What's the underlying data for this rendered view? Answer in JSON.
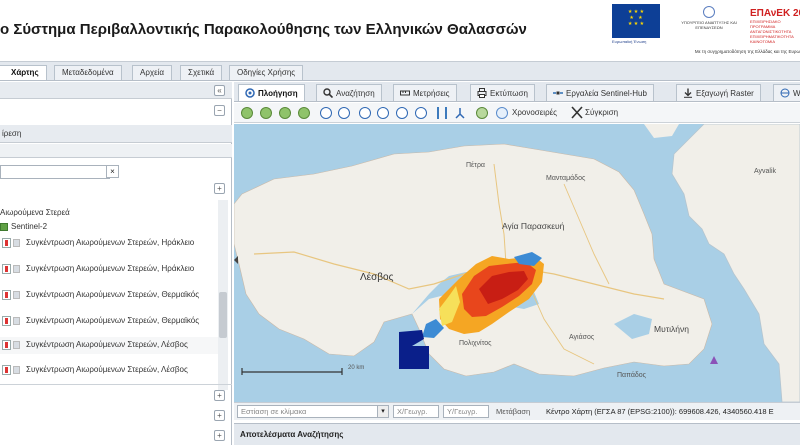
{
  "header": {
    "title": "ο Σύστημα Περιβαλλοντικής Παρακολούθησης των Ελληνικών Θαλασσών",
    "eu_caption": "Ευρωπαϊκή Ένωση",
    "gr_caption": "ΥΠΟΥΡΓΕΙΟ ΑΝΑΠΤΥΞΗΣ ΚΑΙ ΕΠΕΝΔΥΣΕΩΝ",
    "epanek_title": "ΕΠΑνΕΚ 20",
    "epanek_sub": "ΕΠΙΧΕΙΡΗΣΙΑΚΟ ΠΡΟΓΡΑΜΜΑ ΑΝΤΑΓΩΝΙΣΤΙΚΟΤΗΤΑ ΕΠΙΧΕΙΡΗΜΑΤΙΚΟΤΗΤΑ ΚΑΙΝΟΤΟΜΙΑ",
    "cofund": "Με τη συγχρηματοδότηση της Ελλάδας και της Ευρω"
  },
  "menu": {
    "tabs": [
      {
        "label": "Χάρτης",
        "active": true
      },
      {
        "label": "Μεταδεδομένα",
        "active": false
      },
      {
        "label": "Αρχεία",
        "active": false
      },
      {
        "label": "Σχετικά",
        "active": false
      },
      {
        "label": "Οδηγίες Χρήσης",
        "active": false
      }
    ]
  },
  "left_panel": {
    "collapse_symbol": "«",
    "minus_symbol": "−",
    "section_label": "ίρεση",
    "search_clear": "×",
    "group_label": "Αιωρούμενα Στερεά",
    "subgroup_label": "Sentinel-2",
    "layers": [
      "Συγκέντρωση Αιωρούμενων Στερεών, Ηράκλειο",
      "Συγκέντρωση Αιωρούμενων Στερεών, Ηράκλειο",
      "Συγκέντρωση Αιωρούμενων Στερεών, Θερμαϊκός",
      "Συγκέντρωση Αιωρούμενων Στερεών, Θερμαϊκός",
      "Συγκέντρωση Αιωρούμενων Στερεών, Λέσβος",
      "Συγκέντρωση Αιωρούμενων Στερεών, Λέσβος"
    ],
    "plus_symbol": "+"
  },
  "right_panel": {
    "tabs": [
      {
        "label": "Πλοήγηση",
        "active": true
      },
      {
        "label": "Αναζήτηση",
        "active": false
      },
      {
        "label": "Μετρήσεις",
        "active": false
      },
      {
        "label": "Εκτύπωση",
        "active": false
      },
      {
        "label": "Εργαλεία Sentinel-Hub",
        "active": false
      },
      {
        "label": "Εξαγωγή Raster",
        "active": false
      },
      {
        "label": "Wa",
        "active": false
      }
    ],
    "toolbar": {
      "timeseries_label": "Χρονοσειρές",
      "compare_label": "Σύγκριση"
    }
  },
  "map": {
    "place_labels": {
      "petra": "Πέτρα",
      "mantamados": "Μανταμάδος",
      "agia_paraskevi": "Αγία Παρασκευή",
      "lesvos": "Λέσβος",
      "mytilini": "Μυτιλήνη",
      "polichnitos": "Πολιχνίτος",
      "agiasos": "Αγιάσος",
      "plomari": "Παπάδος",
      "ayvalik": "Ayvalik"
    },
    "scale_label": "20 km",
    "water_color": "#a9cfe6",
    "land_color": "#f1efe9"
  },
  "coord_bar": {
    "scale_placeholder": "Εστίαση σε κλίμακα",
    "x_placeholder": "Χ/Γεωγρ.",
    "y_placeholder": "Υ/Γεωγρ.",
    "transform_label": "Μετάβαση",
    "center_text": "Κέντρο Χάρτη (ΕΓΣΑ 87 (EPSG:2100)): 699608.426, 4340560.418 Ε"
  },
  "results": {
    "title": "Αποτελέσματα Αναζήτησης"
  }
}
